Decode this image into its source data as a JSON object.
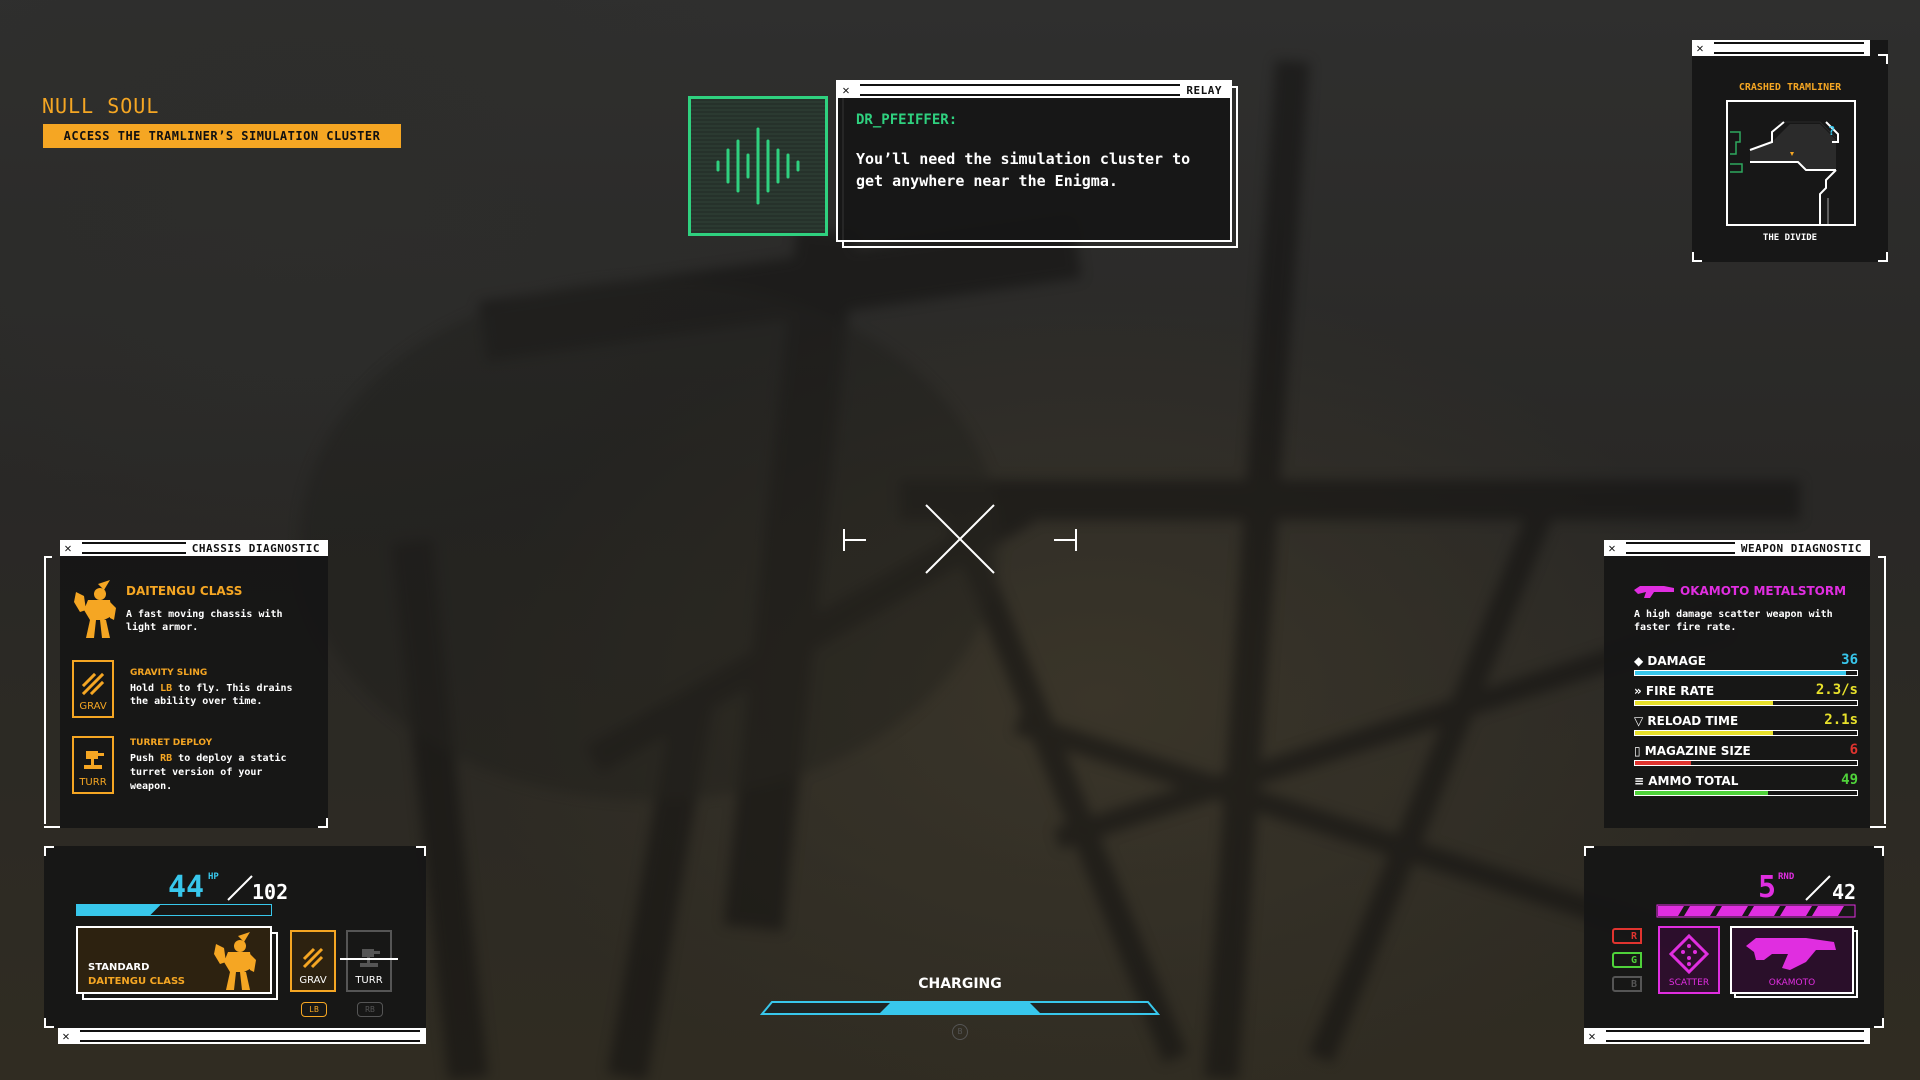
{
  "objective": {
    "title": "NULL SOUL",
    "task": "ACCESS THE TRAMLINER’S SIMULATION CLUSTER"
  },
  "relay": {
    "title": "RELAY",
    "speaker": "DR_PFEIFFER:",
    "message": "You’ll need the simulation cluster to get anywhere near the Enigma."
  },
  "minimap": {
    "location": "CRASHED TRAMLINER",
    "area": "THE DIVIDE",
    "marker": "?"
  },
  "chassis_diagnostic": {
    "title": "CHASSIS DIAGNOSTIC",
    "class_name": "DAITENGU CLASS",
    "class_desc": "A fast moving chassis with light armor.",
    "abilities": [
      {
        "icon_label": "GRAV",
        "name": "GRAVITY SLING",
        "desc_pre": "Hold ",
        "key": "LB",
        "desc_post": " to fly. This drains the ability over time.",
        "icon": "gravity-sling-icon"
      },
      {
        "icon_label": "TURR",
        "name": "TURRET DEPLOY",
        "desc_pre": "Push ",
        "key": "RB",
        "desc_post": " to deploy a static turret version of your weapon.",
        "icon": "turret-icon"
      }
    ]
  },
  "weapon_diagnostic": {
    "title": "WEAPON DIAGNOSTIC",
    "name": "OKAMOTO METALSTORM",
    "desc": "A high damage scatter weapon with faster fire rate.",
    "stats": [
      {
        "icon": "◆",
        "label": "DAMAGE",
        "value": "36",
        "color": "#38c7ec",
        "fill": 0.95
      },
      {
        "icon": "»",
        "label": "FIRE RATE",
        "value": "2.3/s",
        "color": "#e8e12b",
        "fill": 0.62
      },
      {
        "icon": "▽",
        "label": "RELOAD TIME",
        "value": "2.1s",
        "color": "#e8e12b",
        "fill": 0.62
      },
      {
        "icon": "▯",
        "label": "MAGAZINE SIZE",
        "value": "6",
        "color": "#e0342f",
        "fill": 0.25
      },
      {
        "icon": "≡",
        "label": "AMMO TOTAL",
        "value": "49",
        "color": "#4fd23a",
        "fill": 0.6
      }
    ]
  },
  "health": {
    "current": "44",
    "unit": "HP",
    "max": "102",
    "fill": 0.43,
    "loadout_label_1": "STANDARD",
    "loadout_label_2": "DAITENGU CLASS",
    "ability_1": "GRAV",
    "ability_2": "TURR",
    "key_1": "LB",
    "key_2": "RB"
  },
  "ammo": {
    "current": "5",
    "unit": "RND",
    "total": "42",
    "mode_label": "SCATTER",
    "weapon_label": "OKAMOTO",
    "channels": [
      "R",
      "G",
      "B"
    ]
  },
  "charge": {
    "label": "CHARGING",
    "button": "B"
  },
  "colors": {
    "accent_orange": "#f5a623",
    "hp_cyan": "#38c7ec",
    "weapon_magenta": "#e02ee0",
    "relay_green": "#2fd17f"
  }
}
